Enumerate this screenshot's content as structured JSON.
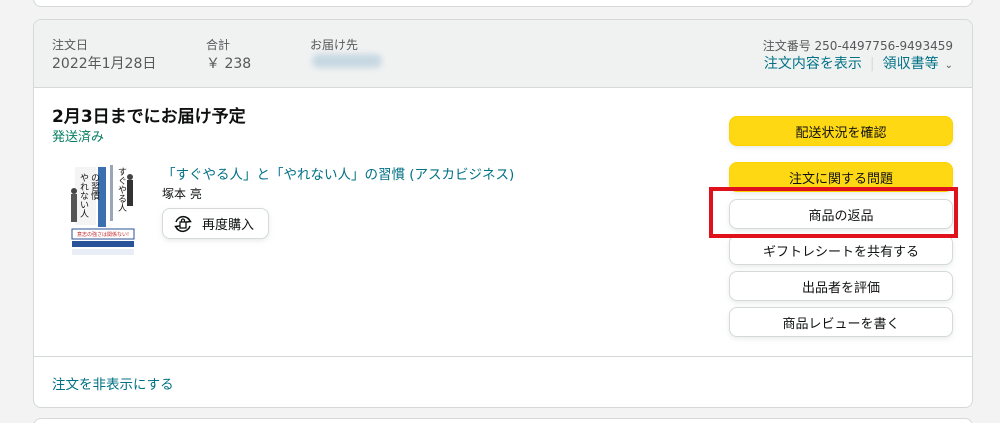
{
  "order_header": {
    "date_label": "注文日",
    "date_value": "2022年1月28日",
    "total_label": "合計",
    "total_value": "￥ 238",
    "ship_to_label": "お届け先",
    "order_number": "注文番号 250-4497756-9493459",
    "view_details_link": "注文内容を表示",
    "receipt_link": "領収書等"
  },
  "shipment": {
    "delivery_title": "2月3日までにお届け予定",
    "status": "発送済み"
  },
  "product": {
    "title": "「すぐやる人」と「やれない人」の習慣 (アスカビジネス)",
    "author": "塚本 亮",
    "rebuy_label": "再度購入",
    "cover_text": {
      "title_a": "すぐやる人",
      "title_b": "やれない人",
      "title_c": "の習慣",
      "band": "意志の強さは関係ない!"
    }
  },
  "actions": {
    "track_package": "配送状況を確認",
    "problem_with_order": "注文に関する問題",
    "return_items": "商品の返品",
    "share_gift_receipt": "ギフトレシートを共有する",
    "seller_feedback": "出品者を評価",
    "write_review": "商品レビューを書く"
  },
  "footer": {
    "hide_order_link": "注文を非表示にする"
  },
  "colors": {
    "link": "#007185",
    "shipped_green": "#067d62",
    "button_yellow": "#ffd814",
    "highlight_red": "#e0111b"
  }
}
